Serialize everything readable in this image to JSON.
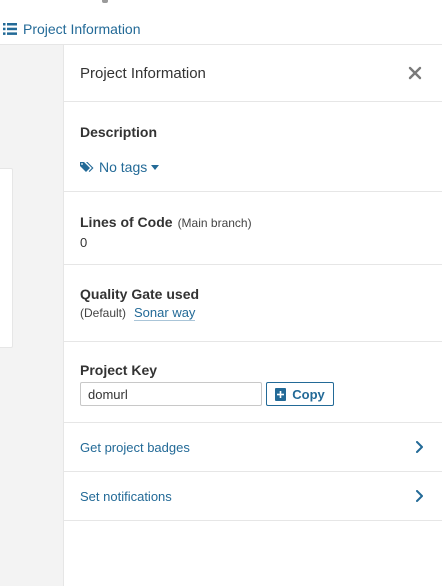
{
  "topbar": {
    "link_label": "Project Information",
    "link_icon": "list-icon"
  },
  "panel": {
    "title": "Project Information",
    "close_icon": "close-icon",
    "description": {
      "title": "Description",
      "tags_label": "No tags",
      "tags_icon": "tags-icon"
    },
    "lines_of_code": {
      "title": "Lines of Code",
      "qualifier": "(Main branch)",
      "value": "0"
    },
    "quality_gate": {
      "title": "Quality Gate used",
      "default_label": "(Default)",
      "gate_name": "Sonar way"
    },
    "project_key": {
      "title": "Project Key",
      "value": "domurl",
      "copy_label": "Copy",
      "copy_icon": "copy-icon"
    },
    "links": [
      {
        "label": "Get project badges",
        "icon": "chevron-right-icon"
      },
      {
        "label": "Set notifications",
        "icon": "chevron-right-icon"
      }
    ]
  },
  "colors": {
    "link": "#236a97",
    "border": "#e6e6e6",
    "background": "#f3f3f3",
    "panel": "#ffffff"
  }
}
